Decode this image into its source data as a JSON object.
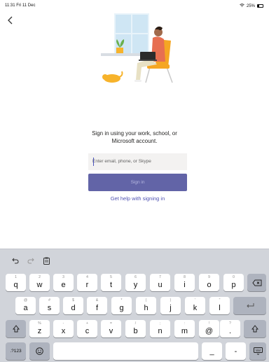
{
  "status_bar": {
    "time": "11:31  Fri 11 Dec",
    "battery": "25%"
  },
  "login": {
    "prompt_line1": "Sign in using your work, school, or",
    "prompt_line2": "Microsoft account.",
    "email_placeholder": "Enter email, phone, or Skype",
    "signin_label": "Sign in",
    "help_link": "Get help with signing in"
  },
  "colors": {
    "accent": "#6264a7",
    "link": "#4f52b2",
    "keyboard_bg": "#d1d4da"
  },
  "keyboard": {
    "toolbar_icons": [
      "undo-icon",
      "redo-icon",
      "paste-icon"
    ],
    "row1": [
      {
        "main": "q",
        "hint": "1"
      },
      {
        "main": "w",
        "hint": "2"
      },
      {
        "main": "e",
        "hint": "3"
      },
      {
        "main": "r",
        "hint": "4"
      },
      {
        "main": "t",
        "hint": "5"
      },
      {
        "main": "y",
        "hint": "6"
      },
      {
        "main": "u",
        "hint": "7"
      },
      {
        "main": "i",
        "hint": "8"
      },
      {
        "main": "o",
        "hint": "9"
      },
      {
        "main": "p",
        "hint": "0"
      }
    ],
    "row2": [
      {
        "main": "a",
        "hint": "@"
      },
      {
        "main": "s",
        "hint": "#"
      },
      {
        "main": "d",
        "hint": "$"
      },
      {
        "main": "f",
        "hint": "&"
      },
      {
        "main": "g",
        "hint": "*"
      },
      {
        "main": "h",
        "hint": "("
      },
      {
        "main": "j",
        "hint": ")"
      },
      {
        "main": "k",
        "hint": "'"
      },
      {
        "main": "l",
        "hint": "\""
      }
    ],
    "row3": [
      {
        "main": "z",
        "hint": "%"
      },
      {
        "main": "x",
        "hint": "-"
      },
      {
        "main": "c",
        "hint": "+"
      },
      {
        "main": "v",
        "hint": "="
      },
      {
        "main": "b",
        "hint": "/"
      },
      {
        "main": "n",
        "hint": ";"
      },
      {
        "main": "m",
        "hint": ":"
      },
      {
        "main": "@",
        "hint": "!"
      },
      {
        "main": ".",
        "hint": "?"
      }
    ],
    "numbers_key": ".?123",
    "underscore_key": "_",
    "dash_key": "-"
  }
}
